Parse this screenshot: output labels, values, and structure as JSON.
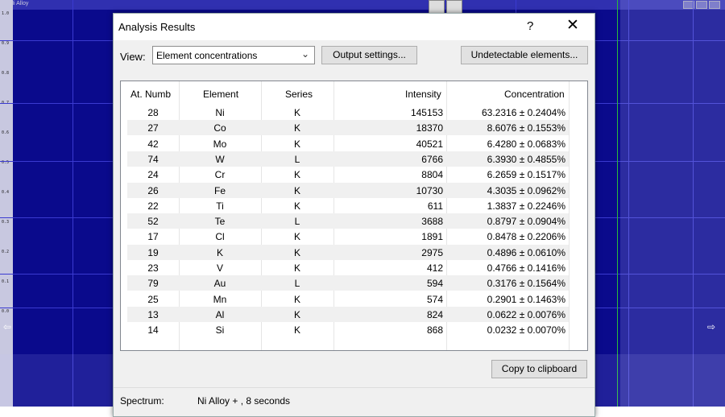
{
  "background": {
    "window_title": "Ni Alloy",
    "y_ticks": [
      "1.0",
      "0.9",
      "0.8",
      "0.7",
      "0.6",
      "0.5",
      "0.4",
      "0.3",
      "0.2",
      "0.1",
      "0.0"
    ]
  },
  "dialog": {
    "title": "Analysis Results",
    "help_glyph": "?",
    "close_glyph": "✕",
    "view_label": "View:",
    "view_value": "Element concentrations",
    "output_settings_label": "Output settings...",
    "undetectable_label": "Undetectable elements...",
    "copy_label": "Copy to clipboard",
    "spectrum_label": "Spectrum:",
    "spectrum_value": "Ni Alloy + ,  8 seconds"
  },
  "table": {
    "headers": [
      "At. Numb",
      "Element",
      "Series",
      "Intensity",
      "Concentration"
    ],
    "rows": [
      [
        "28",
        "Ni",
        "K",
        "145153",
        "63.2316 ± 0.2404%"
      ],
      [
        "27",
        "Co",
        "K",
        "18370",
        "8.6076 ± 0.1553%"
      ],
      [
        "42",
        "Mo",
        "K",
        "40521",
        "6.4280 ± 0.0683%"
      ],
      [
        "74",
        "W",
        "L",
        "6766",
        "6.3930 ± 0.4855%"
      ],
      [
        "24",
        "Cr",
        "K",
        "8804",
        "6.2659 ± 0.1517%"
      ],
      [
        "26",
        "Fe",
        "K",
        "10730",
        "4.3035 ± 0.0962%"
      ],
      [
        "22",
        "Ti",
        "K",
        "611",
        "1.3837 ± 0.2246%"
      ],
      [
        "52",
        "Te",
        "L",
        "3688",
        "0.8797 ± 0.0904%"
      ],
      [
        "17",
        "Cl",
        "K",
        "1891",
        "0.8478 ± 0.2206%"
      ],
      [
        "19",
        "K",
        "K",
        "2975",
        "0.4896 ± 0.0610%"
      ],
      [
        "23",
        "V",
        "K",
        "412",
        "0.4766 ± 0.1416%"
      ],
      [
        "79",
        "Au",
        "L",
        "594",
        "0.3176 ± 0.1564%"
      ],
      [
        "25",
        "Mn",
        "K",
        "574",
        "0.2901 ± 0.1463%"
      ],
      [
        "13",
        "Al",
        "K",
        "824",
        "0.0622 ± 0.0076%"
      ],
      [
        "14",
        "Si",
        "K",
        "868",
        "0.0232 ± 0.0070%"
      ]
    ]
  },
  "colors": {
    "background_plot": "#0a0a8c",
    "grid": "#3a3ad0",
    "marker_line": "#2dbb3a",
    "dialog_bg": "#f0f0f0"
  }
}
